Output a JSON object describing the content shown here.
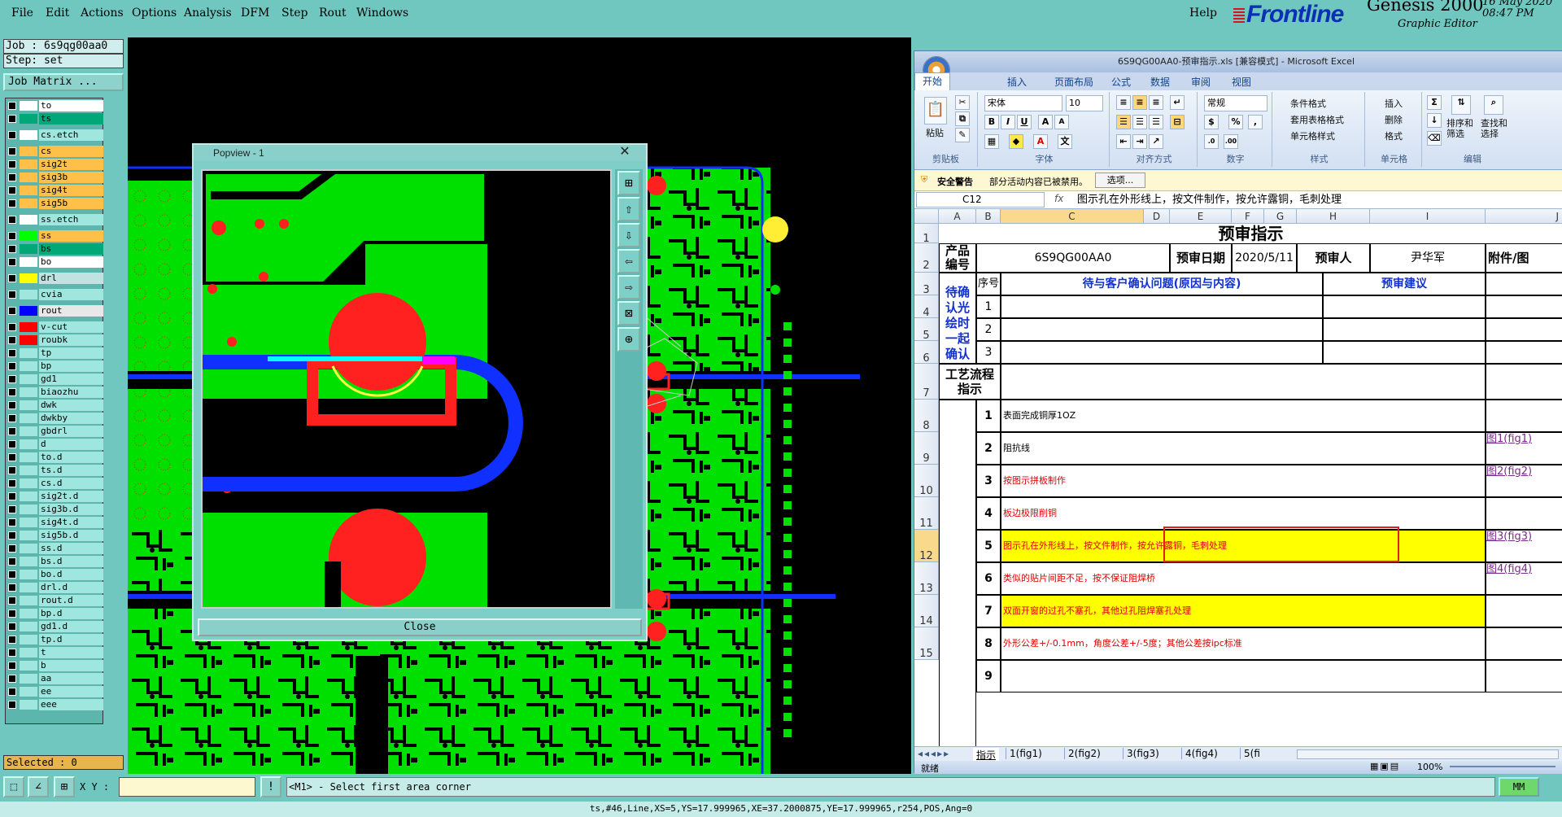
{
  "menu": {
    "file": "File",
    "edit": "Edit",
    "actions": "Actions",
    "options": "Options",
    "analysis": "Analysis",
    "dfm": "DFM",
    "step": "Step",
    "rout": "Rout",
    "windows": "Windows",
    "help": "Help"
  },
  "brand": {
    "logo": "Frontline",
    "app": "Genesis 2000",
    "subtitle": "Graphic Editor",
    "date": "16 May 2020",
    "time": "08:47 PM"
  },
  "job": {
    "job_label": "Job : 6s9qg00aa0",
    "step_label": "Step: set",
    "matrix_button": "Job Matrix ..."
  },
  "layers": [
    {
      "name": "to",
      "color": "#ffffff",
      "name_bg": "#ffffff"
    },
    {
      "name": "ts",
      "color": "#00a878",
      "name_bg": "#00a878"
    },
    {
      "name": "cs.etch",
      "color": "#ffffff",
      "name_bg": "#9fe6df"
    },
    {
      "name": "cs",
      "color": "#ffc04a",
      "name_bg": "#ffc04a"
    },
    {
      "name": "sig2t",
      "color": "#ffc04a",
      "name_bg": "#ffc04a"
    },
    {
      "name": "sig3b",
      "color": "#ffc04a",
      "name_bg": "#ffc04a"
    },
    {
      "name": "sig4t",
      "color": "#ffc04a",
      "name_bg": "#ffc04a"
    },
    {
      "name": "sig5b",
      "color": "#ffc04a",
      "name_bg": "#ffc04a"
    },
    {
      "name": "ss.etch",
      "color": "#ffffff",
      "name_bg": "#9fe6df"
    },
    {
      "name": "ss",
      "color": "#00ff00",
      "name_bg": "#ffc04a"
    },
    {
      "name": "bs",
      "color": "#00a878",
      "name_bg": "#00a878"
    },
    {
      "name": "bo",
      "color": "#ffffff",
      "name_bg": "#ffffff"
    },
    {
      "name": "drl",
      "color": "#ffff00",
      "name_bg": "#bfe3e0"
    },
    {
      "name": "cvia",
      "color": "#9fe6df",
      "name_bg": "#9fe6df"
    },
    {
      "name": "rout",
      "color": "#0000ff",
      "name_bg": "#e8e8e8"
    },
    {
      "name": "v-cut",
      "color": "#ff0000",
      "name_bg": "#9fe6df"
    },
    {
      "name": "roubk",
      "color": "#ff0000",
      "name_bg": "#9fe6df"
    },
    {
      "name": "tp",
      "color": "#9fe6df",
      "name_bg": "#9fe6df"
    },
    {
      "name": "bp",
      "color": "#9fe6df",
      "name_bg": "#9fe6df"
    },
    {
      "name": "gd1",
      "color": "#9fe6df",
      "name_bg": "#9fe6df"
    },
    {
      "name": "biaozhu",
      "color": "#9fe6df",
      "name_bg": "#9fe6df"
    },
    {
      "name": "dwk",
      "color": "#9fe6df",
      "name_bg": "#9fe6df"
    },
    {
      "name": "dwkby",
      "color": "#9fe6df",
      "name_bg": "#9fe6df"
    },
    {
      "name": "gbdrl",
      "color": "#9fe6df",
      "name_bg": "#9fe6df"
    },
    {
      "name": "d",
      "color": "#9fe6df",
      "name_bg": "#9fe6df"
    },
    {
      "name": "to.d",
      "color": "#9fe6df",
      "name_bg": "#9fe6df"
    },
    {
      "name": "ts.d",
      "color": "#9fe6df",
      "name_bg": "#9fe6df"
    },
    {
      "name": "cs.d",
      "color": "#9fe6df",
      "name_bg": "#9fe6df"
    },
    {
      "name": "sig2t.d",
      "color": "#9fe6df",
      "name_bg": "#9fe6df"
    },
    {
      "name": "sig3b.d",
      "color": "#9fe6df",
      "name_bg": "#9fe6df"
    },
    {
      "name": "sig4t.d",
      "color": "#9fe6df",
      "name_bg": "#9fe6df"
    },
    {
      "name": "sig5b.d",
      "color": "#9fe6df",
      "name_bg": "#9fe6df"
    },
    {
      "name": "ss.d",
      "color": "#9fe6df",
      "name_bg": "#9fe6df"
    },
    {
      "name": "bs.d",
      "color": "#9fe6df",
      "name_bg": "#9fe6df"
    },
    {
      "name": "bo.d",
      "color": "#9fe6df",
      "name_bg": "#9fe6df"
    },
    {
      "name": "drl.d",
      "color": "#9fe6df",
      "name_bg": "#9fe6df"
    },
    {
      "name": "rout.d",
      "color": "#9fe6df",
      "name_bg": "#9fe6df"
    },
    {
      "name": "bp.d",
      "color": "#9fe6df",
      "name_bg": "#9fe6df"
    },
    {
      "name": "gd1.d",
      "color": "#9fe6df",
      "name_bg": "#9fe6df"
    },
    {
      "name": "tp.d",
      "color": "#9fe6df",
      "name_bg": "#9fe6df"
    },
    {
      "name": "t",
      "color": "#9fe6df",
      "name_bg": "#9fe6df"
    },
    {
      "name": "b",
      "color": "#9fe6df",
      "name_bg": "#9fe6df"
    },
    {
      "name": "aa",
      "color": "#9fe6df",
      "name_bg": "#9fe6df"
    },
    {
      "name": "ee",
      "color": "#9fe6df",
      "name_bg": "#9fe6df"
    },
    {
      "name": "eee",
      "color": "#9fe6df",
      "name_bg": "#9fe6df"
    }
  ],
  "selected": "Selected : 0",
  "popview": {
    "title": "Popview - 1",
    "close": "Close",
    "close_x": "✕"
  },
  "excel": {
    "title": "6S9QG00AA0-预审指示.xls [兼容模式] - Microsoft Excel",
    "tabs": [
      "开始",
      "插入",
      "页面布局",
      "公式",
      "数据",
      "审阅",
      "视图"
    ],
    "font_name": "宋体",
    "font_size": "10",
    "number_format": "常规",
    "groups": {
      "clipboard": "剪贴板",
      "font": "字体",
      "align": "对齐方式",
      "number": "数字",
      "style": "样式",
      "cells": "单元格",
      "edit": "编辑"
    },
    "paste": "粘贴",
    "style_items": [
      "条件格式",
      "套用表格格式",
      "单元格样式"
    ],
    "cell_items": [
      "插入",
      "删除",
      "格式"
    ],
    "edit_items": [
      "排序和筛选",
      "查找和选择"
    ],
    "security_title": "安全警告",
    "security_msg": "部分活动内容已被禁用。",
    "options_btn": "选项...",
    "name_box": "C12",
    "fx": "fx",
    "formula": "图示孔在外形线上，按文件制作，按允许露铜，毛刺处理",
    "columns": [
      "A",
      "B",
      "C",
      "D",
      "E",
      "F",
      "G",
      "H",
      "I",
      "J"
    ],
    "rows": [
      "1",
      "2",
      "3",
      "4",
      "5",
      "6",
      "7",
      "8",
      "9",
      "10",
      "11",
      "12",
      "13",
      "14",
      "15"
    ],
    "sheet_title": "预审指示",
    "product_label": "产品编号",
    "product_value": "6S9QG00AA0",
    "date_label": "预审日期",
    "date_value": "2020/5/11",
    "reviewer_label": "预审人",
    "reviewer_value": "尹华军",
    "attach_label": "附件/图",
    "pending_label": "待确认光绘时一起确认问题",
    "seq_label": "序号",
    "issue_header": "待与客户确认问题(原因与内容)",
    "suggest_header": "预审建议",
    "pending_rows": [
      "1",
      "2",
      "3"
    ],
    "process_label": "工艺流程指示",
    "items": [
      {
        "no": "1",
        "text": "表面完成铜厚1OZ",
        "link": ""
      },
      {
        "no": "2",
        "text": "阻抗线",
        "link": "图1(fig1)"
      },
      {
        "no": "3",
        "text": "按图示拼板制作",
        "link": "图2(fig2)"
      },
      {
        "no": "4",
        "text": "板边极限削铜",
        "link": ""
      },
      {
        "no": "5",
        "text": "图示孔在外形线上，按文件制作，按允许露铜，毛刺处理",
        "link": "图3(fig3)"
      },
      {
        "no": "6",
        "text": "类似的贴片间距不足，按不保证阻焊桥",
        "link": "图4(fig4)"
      },
      {
        "no": "7",
        "text": "双面开窗的过孔不塞孔，其他过孔阻焊塞孔处理",
        "link": ""
      },
      {
        "no": "8",
        "text": "外形公差+/-0.1mm，角度公差+/-5度；其他公差按ipc标准",
        "link": ""
      },
      {
        "no": "9",
        "text": "",
        "link": ""
      }
    ],
    "sheet_tabs": [
      "指示",
      "1(fig1)",
      "2(fig2)",
      "3(fig3)",
      "4(fig4)",
      "5(fi"
    ],
    "status_ready": "就绪",
    "zoom": "100%"
  },
  "bottom": {
    "xy_label": "X Y :",
    "prompt": "<M1> - Select first area corner",
    "units": "MM",
    "status": "ts,#46,Line,XS=5,YS=17.999965,XE=37.2000875,YE=17.999965,r254,POS,Ang=0"
  }
}
